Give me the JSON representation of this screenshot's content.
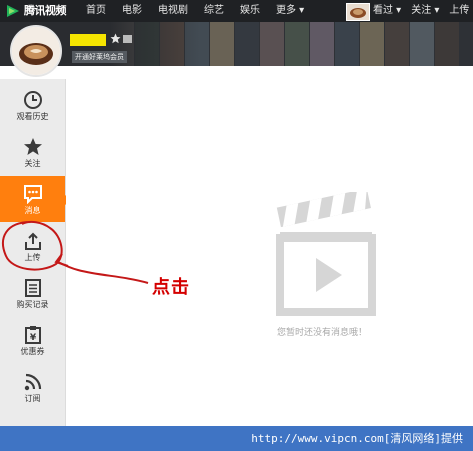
{
  "brand": {
    "name": "腾讯视频"
  },
  "nav": {
    "items": [
      "首页",
      "电影",
      "电视剧",
      "综艺",
      "娱乐"
    ],
    "more": "更多"
  },
  "user_menu": {
    "items": [
      "看过",
      "关注",
      "上传"
    ]
  },
  "profile": {
    "vip_label": "开通好莱坞会员"
  },
  "sidebar": {
    "items": [
      {
        "label": "观看历史",
        "icon": "clock-icon"
      },
      {
        "label": "关注",
        "icon": "star-icon"
      },
      {
        "label": "消息",
        "icon": "message-icon",
        "active": true
      },
      {
        "label": "上传",
        "icon": "upload-icon"
      },
      {
        "label": "购买记录",
        "icon": "receipt-icon"
      },
      {
        "label": "优惠券",
        "icon": "coupon-icon"
      },
      {
        "label": "订阅",
        "icon": "rss-icon"
      }
    ]
  },
  "main": {
    "empty_message": "您暂时还没有消息哦！"
  },
  "annotation": {
    "text": "点击"
  },
  "footer": {
    "text": "http://www.vipcn.com[清风网络]提供"
  },
  "colors": {
    "accent": "#ff7f0e",
    "topbar": "#1f2124",
    "footer": "#3f74c4",
    "annotation": "#d40000"
  }
}
